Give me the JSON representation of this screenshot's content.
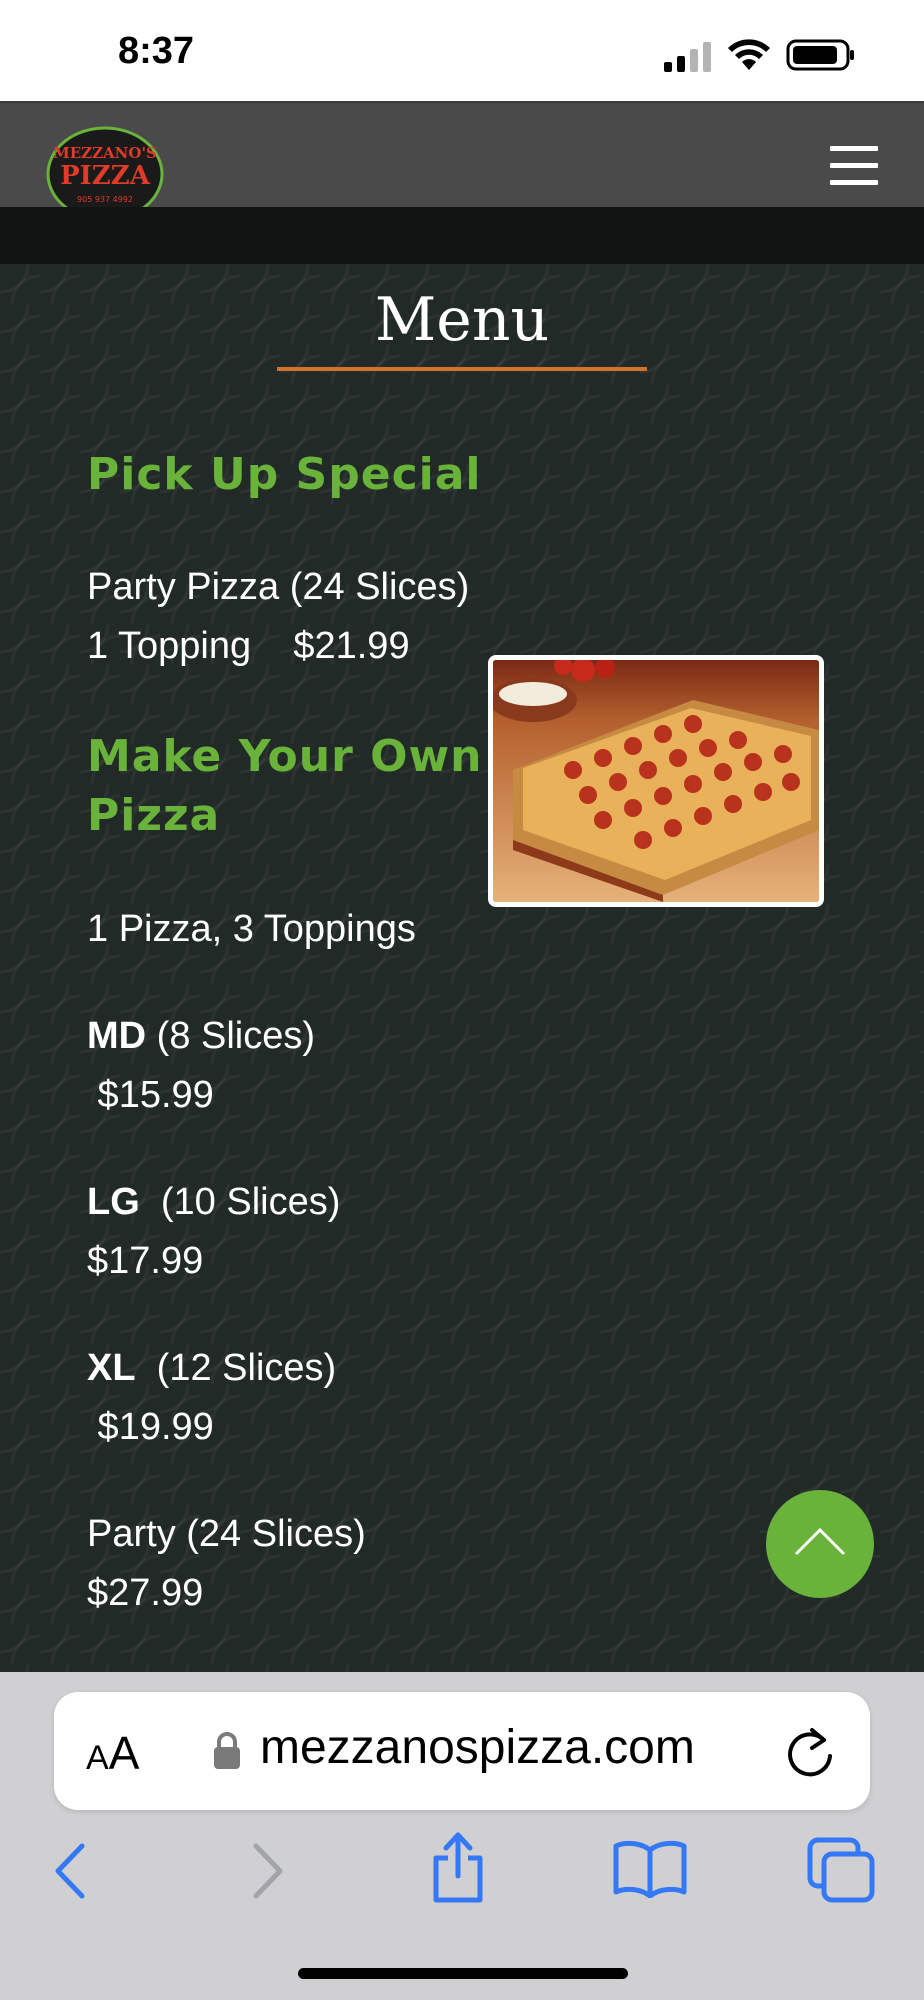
{
  "status_bar": {
    "time": "8:37"
  },
  "site": {
    "logo": {
      "name": "MEZZANO'S",
      "word": "PIZZA",
      "phone": "905 937 4992"
    },
    "menu_title": "Menu"
  },
  "menu": {
    "pickup_special": {
      "heading": "Pick Up Special",
      "line1": "Party Pizza (24 Slices)",
      "line2": "1 Topping    $21.99"
    },
    "make_your_own": {
      "heading_line1": "Make Your Own",
      "heading_line2": "Pizza",
      "intro": "1 Pizza, 3 Toppings",
      "sizes": [
        {
          "size": "MD",
          "slices": " (8 Slices)",
          "price": " $15.99"
        },
        {
          "size": "LG",
          "slices": "  (10 Slices)",
          "price": "$17.99"
        },
        {
          "size": "XL",
          "slices": "  (12 Slices)",
          "price": " $19.99"
        },
        {
          "size": "",
          "slices": "Party (24 Slices)",
          "price": "$27.99"
        }
      ]
    }
  },
  "browser": {
    "aa_small": "A",
    "aa_big": "A",
    "url": "mezzanospizza.com"
  },
  "colors": {
    "accent_green": "#6ab33a",
    "rule_orange": "#d4722a",
    "header_gray": "#4a4a4a",
    "ios_blue": "#3478f6"
  }
}
